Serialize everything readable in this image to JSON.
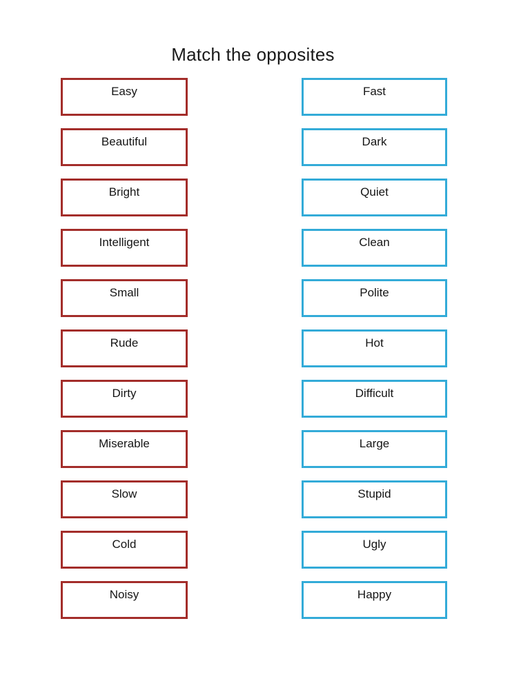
{
  "worksheet": {
    "title": "Match the opposites",
    "left_column": {
      "accent_color": "#a32d2a",
      "items": [
        {
          "label": "Easy"
        },
        {
          "label": "Beautiful"
        },
        {
          "label": "Bright"
        },
        {
          "label": "Intelligent"
        },
        {
          "label": "Small"
        },
        {
          "label": "Rude"
        },
        {
          "label": "Dirty"
        },
        {
          "label": "Miserable"
        },
        {
          "label": "Slow"
        },
        {
          "label": "Cold"
        },
        {
          "label": "Noisy"
        }
      ]
    },
    "right_column": {
      "accent_color": "#33abd8",
      "items": [
        {
          "label": "Fast"
        },
        {
          "label": "Dark"
        },
        {
          "label": "Quiet"
        },
        {
          "label": "Clean"
        },
        {
          "label": "Polite"
        },
        {
          "label": "Hot"
        },
        {
          "label": "Difficult"
        },
        {
          "label": "Large"
        },
        {
          "label": "Stupid"
        },
        {
          "label": "Ugly"
        },
        {
          "label": "Happy"
        }
      ]
    }
  }
}
